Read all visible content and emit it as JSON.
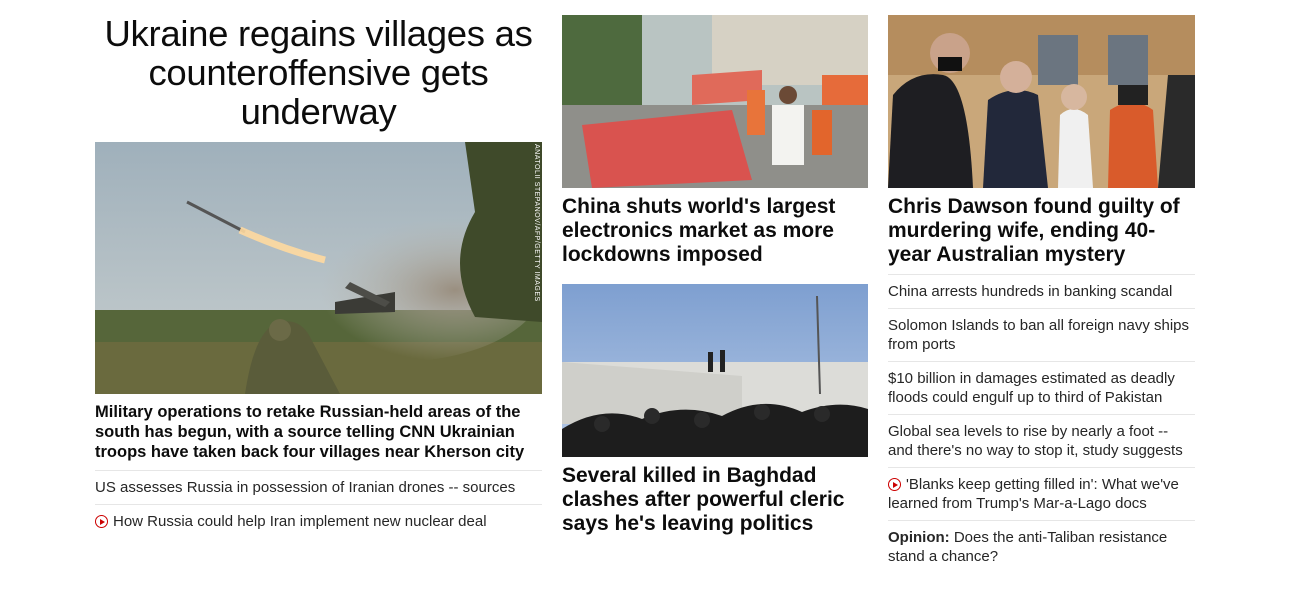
{
  "lead": {
    "headline": "Ukraine regains villages as counteroffensive gets underway",
    "image_credit": "ANATOLII STEPANOV/AFP/GETTY IMAGES",
    "description": "Military operations to retake Russian-held areas of the south has begun, with a source telling CNN Ukrainian troops have taken back four villages near Kherson city",
    "related": [
      {
        "text": "US assesses Russia in possession of Iranian drones -- sources",
        "video": false
      },
      {
        "text": "How Russia could help Iran implement new nuclear deal",
        "video": true
      }
    ]
  },
  "middle": [
    {
      "title": "China shuts world's largest electronics market as more lockdowns imposed"
    },
    {
      "title": "Several killed in Baghdad clashes after powerful cleric says he's leaving politics"
    }
  ],
  "right": {
    "title": "Chris Dawson found guilty of murdering wife, ending 40-year Australian mystery",
    "links": [
      {
        "text": "China arrests hundreds in banking scandal"
      },
      {
        "text": "Solomon Islands to ban all foreign navy ships from ports"
      },
      {
        "text": "$10 billion in damages estimated as deadly floods could engulf up to third of Pakistan"
      },
      {
        "text": "Global sea levels to rise by nearly a foot -- and there's no way to stop it, study suggests"
      },
      {
        "text": "'Blanks keep getting filled in': What we've learned from Trump's Mar-a-Lago docs",
        "video": true
      },
      {
        "label": "Opinion:",
        "text": "Does the anti-Taliban resistance stand a chance?"
      }
    ]
  },
  "colors": {
    "video_icon": "#cc0000",
    "divider": "#e6e6e6"
  }
}
